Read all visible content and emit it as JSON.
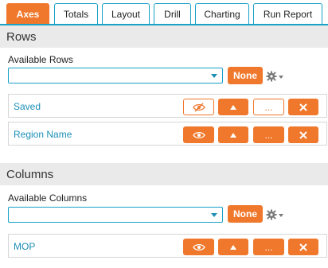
{
  "tabs": [
    {
      "label": "Axes",
      "active": true
    },
    {
      "label": "Totals",
      "active": false
    },
    {
      "label": "Layout",
      "active": false
    },
    {
      "label": "Drill",
      "active": false
    },
    {
      "label": "Charting",
      "active": false
    },
    {
      "label": "Run Report",
      "active": false
    }
  ],
  "rows_section": {
    "title": "Rows",
    "available_label": "Available Rows",
    "select_value": "",
    "none_button": "None",
    "items": [
      {
        "label": "Saved",
        "visibility_state": "hidden",
        "more": "...",
        "icons": [
          "eye-slash-icon",
          "up-arrow-icon",
          "close-icon"
        ]
      },
      {
        "label": "Region Name",
        "visibility_state": "visible",
        "more": "...",
        "icons": [
          "eye-icon",
          "up-arrow-icon",
          "close-icon"
        ]
      }
    ]
  },
  "columns_section": {
    "title": "Columns",
    "available_label": "Available Columns",
    "select_value": "",
    "none_button": "None",
    "items": [
      {
        "label": "MOP",
        "visibility_state": "visible",
        "more": "...",
        "icons": [
          "eye-icon",
          "up-arrow-icon",
          "close-icon"
        ]
      }
    ]
  },
  "colors": {
    "accent": "#f0782c",
    "link": "#1b8fb6",
    "tab_border": "#18a0c8",
    "section_bg": "#eaeaea"
  }
}
